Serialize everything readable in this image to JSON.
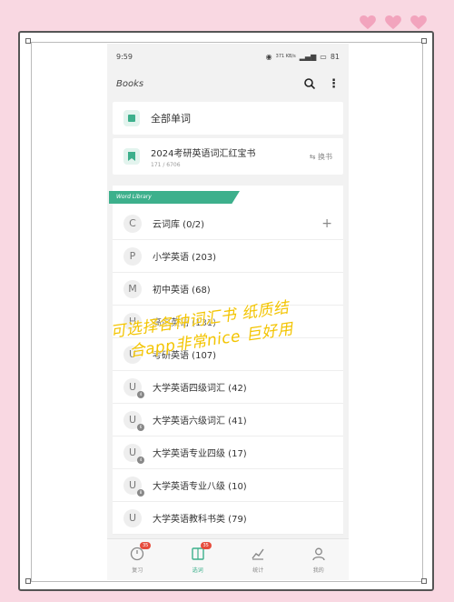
{
  "status_bar": {
    "time": "9:59",
    "signal": "371 KB/s",
    "battery": "81"
  },
  "app_bar": {
    "title": "Books"
  },
  "all_words": {
    "label": "全部单词"
  },
  "current_book": {
    "title": "2024考研英语词汇红宝书",
    "progress": "171 / 6706",
    "swap_label": "换书"
  },
  "library": {
    "ribbon": "Word Library",
    "items": [
      {
        "letter": "C",
        "label": "云词库 (0/2)",
        "sub": ""
      },
      {
        "letter": "P",
        "label": "小学英语 (203)",
        "sub": ""
      },
      {
        "letter": "M",
        "label": "初中英语 (68)",
        "sub": ""
      },
      {
        "letter": "H",
        "label": "高中英语 (131)",
        "sub": ""
      },
      {
        "letter": "U",
        "label": "考研英语 (107)",
        "sub": ""
      },
      {
        "letter": "U",
        "label": "大学英语四级词汇 (42)",
        "sub": "4"
      },
      {
        "letter": "U",
        "label": "大学英语六级词汇 (41)",
        "sub": "6"
      },
      {
        "letter": "U",
        "label": "大学英语专业四级 (17)",
        "sub": "4"
      },
      {
        "letter": "U",
        "label": "大学英语专业八级 (10)",
        "sub": "8"
      },
      {
        "letter": "U",
        "label": "大学英语教科书类 (79)",
        "sub": ""
      }
    ]
  },
  "tabs": [
    {
      "label": "复习",
      "badge": "35",
      "icon": "review-icon"
    },
    {
      "label": "选词",
      "badge": "35",
      "icon": "book-icon"
    },
    {
      "label": "统计",
      "badge": "",
      "icon": "chart-icon"
    },
    {
      "label": "我的",
      "badge": "",
      "icon": "user-icon"
    }
  ],
  "overlay_text": {
    "line1": "可选择各种词汇书 纸质结",
    "line2": "合app非常nice 巨好用"
  },
  "colors": {
    "accent": "#3db08c",
    "background": "#f9d8e2",
    "overlay": "#f3c400",
    "badge": "#e64c3c"
  }
}
